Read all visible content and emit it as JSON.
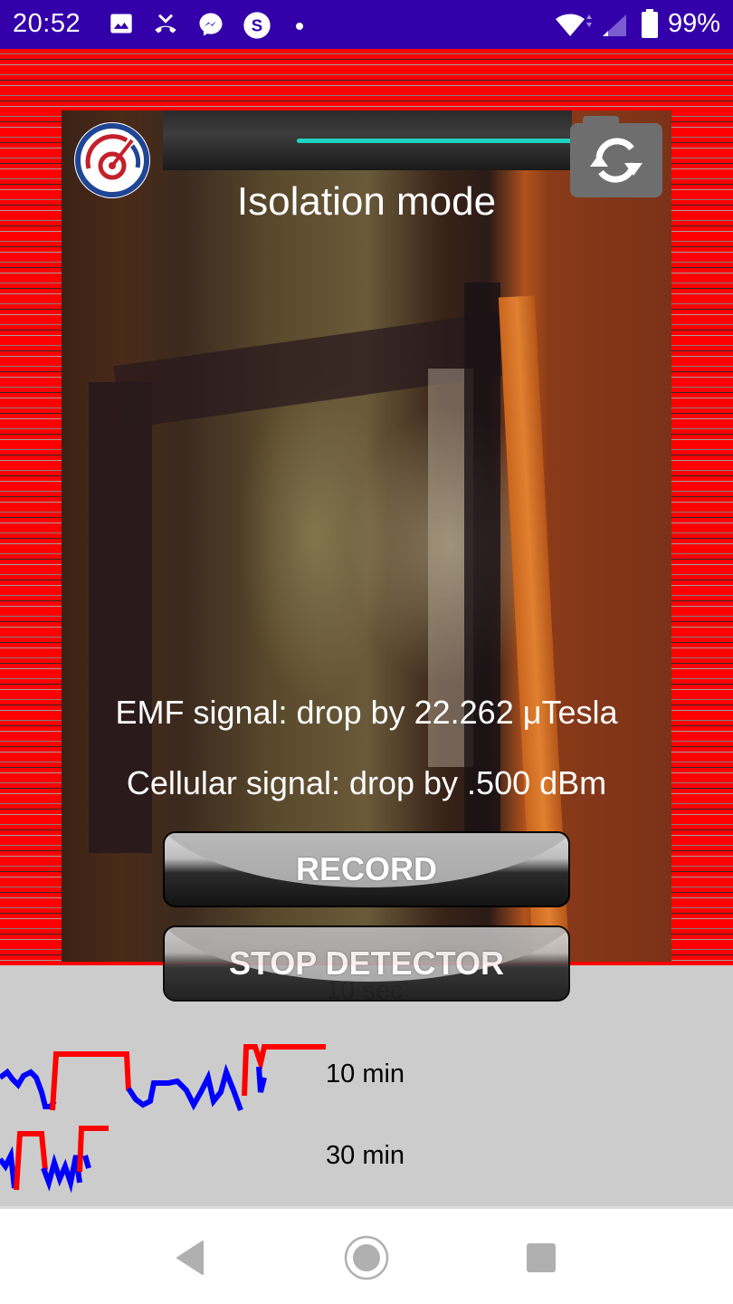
{
  "status_bar": {
    "time": "20:52",
    "notification_icons": [
      "image-icon",
      "missed-call-icon",
      "messenger-icon",
      "skype-icon",
      "dot-icon"
    ],
    "system_icons": [
      "wifi-icon",
      "cell-signal-icon",
      "battery-icon"
    ],
    "battery_percent": "99%",
    "background_color": "#3300aa"
  },
  "app": {
    "logo_icon": "gauge-logo-icon",
    "sensitivity_slider": {
      "value_percent": 100,
      "color": "#1fd4c0"
    },
    "switch_camera_icon": "switch-camera-icon",
    "mode_title": "Isolation mode",
    "emf_signal": "EMF signal: drop by 22.262 μTesla",
    "cellular_signal": "Cellular signal: drop by .500 dBm",
    "buttons": {
      "record": "RECORD",
      "stop_detector": "STOP DETECTOR"
    },
    "alert_color": "#ff0000"
  },
  "graphs": {
    "labels": {
      "short": "10 sec",
      "medium": "10 min",
      "long": "30 min"
    },
    "series_colors": {
      "signal": "#0000ff",
      "alert": "#ff0000"
    }
  },
  "nav_bar": {
    "back": "back-icon",
    "home": "home-icon",
    "recents": "recents-icon"
  }
}
